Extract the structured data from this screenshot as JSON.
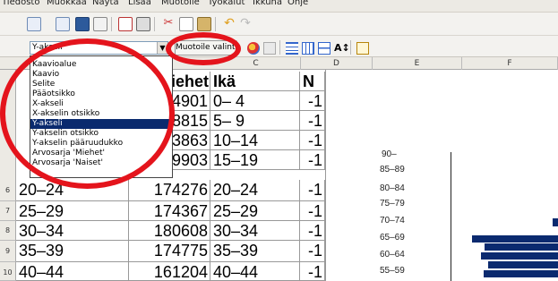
{
  "menu": [
    "Tiedosto",
    "Muokkaa",
    "Näytä",
    "Lisää",
    "Muotoile",
    "Työkalut",
    "Ikkuna",
    "Ohje"
  ],
  "toolbar2": {
    "selected_element": "Y-akseli",
    "format_selection_button": "Muotoile valinta"
  },
  "element_list": {
    "items": [
      "Kaavioalue",
      "Kaavio",
      "Selite",
      "Pääotsikko",
      "X-akseli",
      "X-akselin otsikko",
      "Y-akseli",
      "Y-akselin otsikko",
      "Y-akselin pääruudukko",
      "Arvosarja 'Miehet'",
      "Arvosarja 'Naiset'"
    ],
    "selected_index": 6
  },
  "sheet": {
    "columns": [
      "C",
      "D",
      "E",
      "F"
    ],
    "header_row": {
      "col_a_partial": "",
      "col_b": "Miehet",
      "col_c": "Ikä",
      "col_d": "N"
    },
    "rows": [
      {
        "num": "",
        "age": "",
        "men": "4901",
        "age_c": "0– 4",
        "d": "-1"
      },
      {
        "num": "",
        "age": "",
        "men": "8815",
        "age_c": "5– 9",
        "d": "-1"
      },
      {
        "num": "",
        "age": "",
        "men": "3863",
        "age_c": "10–14",
        "d": "-1"
      },
      {
        "num": "",
        "age": "",
        "men": "9903",
        "age_c": "15–19",
        "d": "-1"
      },
      {
        "num": "6",
        "age": "20–24",
        "men": "174276",
        "age_c": "20–24",
        "d": "-1"
      },
      {
        "num": "7",
        "age": "25–29",
        "men": "174367",
        "age_c": "25–29",
        "d": "-1"
      },
      {
        "num": "8",
        "age": "30–34",
        "men": "180608",
        "age_c": "30–34",
        "d": "-1"
      },
      {
        "num": "9",
        "age": "35–39",
        "men": "174775",
        "age_c": "35–39",
        "d": "-1"
      },
      {
        "num": "10",
        "age": "40–44",
        "men": "161204",
        "age_c": "40–44",
        "d": "-1"
      }
    ]
  },
  "chart": {
    "y_labels": [
      "90–",
      "85–89",
      "80–84",
      "75–79",
      "70–74",
      "65–69",
      "60–64",
      "55–59"
    ],
    "bar_color": "#0b2a6f"
  },
  "highlight_color": "#e4141c"
}
